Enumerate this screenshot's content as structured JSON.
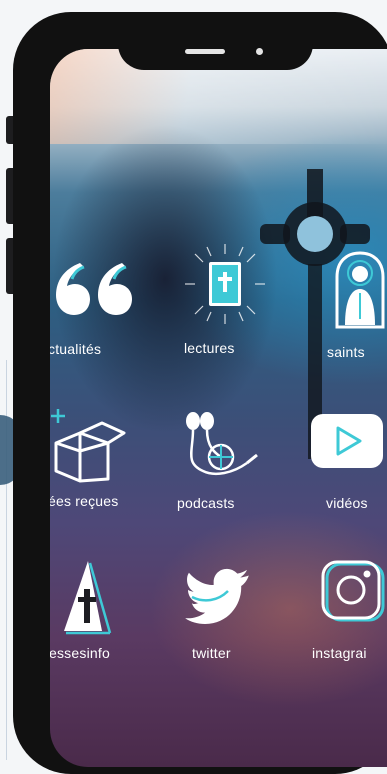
{
  "apps": [
    {
      "label": "ctualités",
      "icon": "quote-icon"
    },
    {
      "label": "lectures",
      "icon": "bible-icon"
    },
    {
      "label": "saints",
      "icon": "saint-icon"
    },
    {
      "label": "ées reçues",
      "icon": "box-icon"
    },
    {
      "label": "podcasts",
      "icon": "earphones-icon"
    },
    {
      "label": "vidéos",
      "icon": "play-icon"
    },
    {
      "label": "essesinfo",
      "icon": "church-icon"
    },
    {
      "label": "twitter",
      "icon": "twitter-icon"
    },
    {
      "label": "instagrai",
      "icon": "instagram-icon"
    }
  ],
  "colors": {
    "accent": "#3ec9d6",
    "label": "#ffffff",
    "frame": "#111111"
  }
}
